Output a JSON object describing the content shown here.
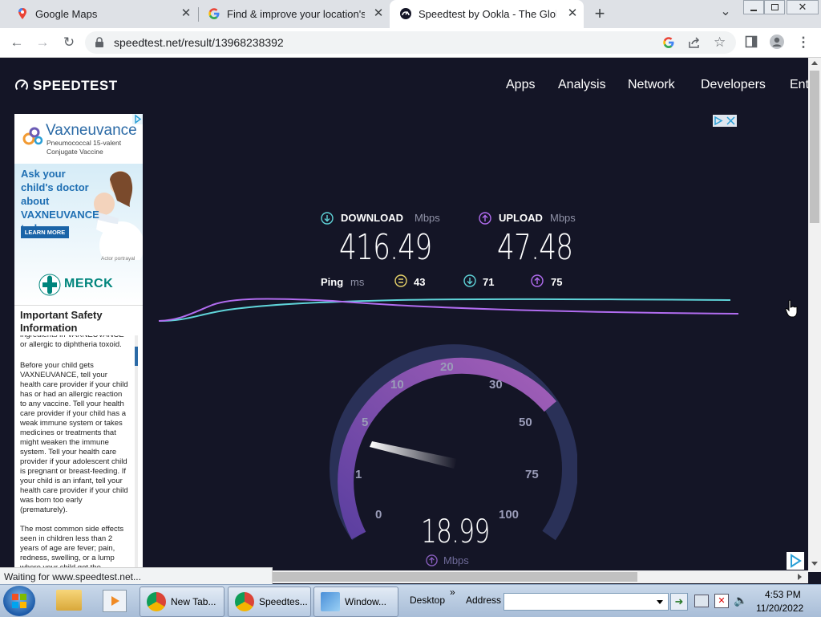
{
  "browser": {
    "tabs": [
      {
        "title": "Google Maps"
      },
      {
        "title": "Find & improve your location's ac"
      },
      {
        "title": "Speedtest by Ookla - The Global"
      }
    ],
    "new_tab": "+",
    "tab_search": "⌄",
    "url": "speedtest.net/result/13968238392",
    "status_text": "Waiting for www.speedtest.net..."
  },
  "site": {
    "logo": "SPEEDTEST",
    "nav": [
      "Apps",
      "Analysis",
      "Network",
      "Developers",
      "Ent"
    ]
  },
  "ad": {
    "brand": "Vaxneuvance",
    "brand_sub1": "Pneumococcal 15-valent",
    "brand_sub2": "Conjugate Vaccine",
    "headline": "Ask your child's doctor about VAXNEUVANCE today.",
    "cta": "LEARN MORE",
    "portrayal": "Actor portrayal",
    "sponsor": "MERCK",
    "isi_title": "Important Safety Information",
    "isi_para0": "ingredients in VAXNEUVANCE or allergic to diphtheria toxoid.",
    "isi_para1": "Before your child gets VAXNEUVANCE, tell your health care provider if your child has or had an allergic reaction to any vaccine. Tell your health care provider if your child has a weak immune system or takes medicines or treatments that might weaken the immune system. Tell your health care provider if your adolescent child is pregnant or breast-feeding. If your child is an infant, tell your health care provider if your child was born too early (prematurely).",
    "isi_para2": "The most common side effects seen in children less than 2 years of age are fever; pain, redness, swelling, or a lump where your child got the"
  },
  "result": {
    "download_label": "DOWNLOAD",
    "upload_label": "UPLOAD",
    "unit": "Mbps",
    "download": "416.49",
    "upload": "47.48",
    "ping_label": "Ping",
    "ping_unit": "ms",
    "ping": "43",
    "ping_down": "71",
    "ping_up": "75",
    "gauge_value": "18.99",
    "gauge_unit": "Mbps",
    "gauge_ticks": [
      "0",
      "1",
      "5",
      "10",
      "20",
      "30",
      "50",
      "75",
      "100"
    ]
  },
  "taskbar": {
    "buttons": [
      "New Tab...",
      "Speedtes...",
      "Window..."
    ],
    "desktop": "Desktop",
    "address_label": "Address",
    "time": "4:53 PM",
    "date": "11/20/2022"
  },
  "colors": {
    "download": "#5fd3d8",
    "upload": "#b16cf0",
    "page_bg": "#141526"
  }
}
